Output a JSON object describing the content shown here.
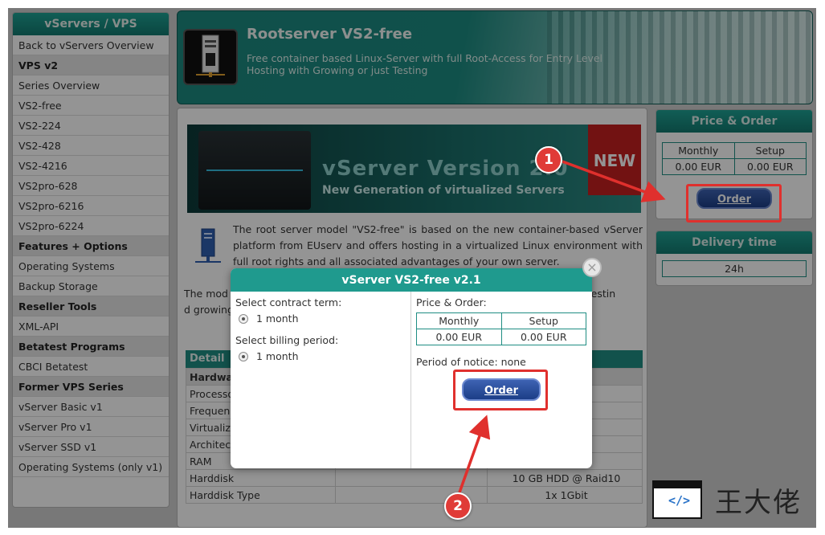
{
  "sidebar": {
    "title": "vServers / VPS",
    "items": [
      {
        "label": "Back to vServers Overview",
        "type": "item"
      },
      {
        "label": "VPS v2",
        "type": "head"
      },
      {
        "label": "Series Overview",
        "type": "item"
      },
      {
        "label": "VS2-free",
        "type": "item"
      },
      {
        "label": "VS2-224",
        "type": "item"
      },
      {
        "label": "VS2-428",
        "type": "item"
      },
      {
        "label": "VS2-4216",
        "type": "item"
      },
      {
        "label": "VS2pro-628",
        "type": "item"
      },
      {
        "label": "VS2pro-6216",
        "type": "item"
      },
      {
        "label": "VS2pro-6224",
        "type": "item"
      },
      {
        "label": "Features + Options",
        "type": "head"
      },
      {
        "label": "Operating Systems",
        "type": "item"
      },
      {
        "label": "Backup Storage",
        "type": "item"
      },
      {
        "label": "Reseller Tools",
        "type": "head"
      },
      {
        "label": "XML-API",
        "type": "item"
      },
      {
        "label": "Betatest Programs",
        "type": "head"
      },
      {
        "label": "CBCI Betatest",
        "type": "item"
      },
      {
        "label": "Former VPS Series",
        "type": "head"
      },
      {
        "label": "vServer Basic v1",
        "type": "item"
      },
      {
        "label": "vServer Pro v1",
        "type": "item"
      },
      {
        "label": "vServer SSD v1",
        "type": "item"
      },
      {
        "label": "Operating Systems (only v1)",
        "type": "item"
      }
    ]
  },
  "header": {
    "title": "Rootserver VS2-free",
    "subtitle": "Free container based Linux-Server with full Root-Access for Entry Level Hosting with Growing or just Testing"
  },
  "banner": {
    "title": "vServer Version 2.0",
    "subtitle": "New Generation of virtualized Servers",
    "new_badge": "NEW"
  },
  "description": {
    "para1": "The root server model \"VS2-free\" is based on the new container-based vServer platform from EUserv and offers hosting in a virtualized Linux environment with full root rights and all associated advantages of your own server.",
    "para2": "The mod                                                                                          nd is ideal for testin                                                                                        d growing systems."
  },
  "detail": {
    "heading": "Detail",
    "rows": [
      {
        "c1": "Hardwa",
        "c2": "",
        "c3": "",
        "sub": true
      },
      {
        "c1": "Processo",
        "c2": "",
        "c3": ""
      },
      {
        "c1": "Frequen",
        "c2": "",
        "c3": "Hz"
      },
      {
        "c1": "Virtualiz",
        "c2": "",
        "c3": "er"
      },
      {
        "c1": "Architec",
        "c2": "",
        "c3": ""
      },
      {
        "c1": "RAM",
        "c2": "",
        "c3": ""
      },
      {
        "c1": "Harddisk",
        "c2": "",
        "c3": "10 GB HDD @ Raid10"
      },
      {
        "c1": "Harddisk Type",
        "c2": "",
        "c3": "1x 1Gbit"
      }
    ]
  },
  "price_panel": {
    "title": "Price & Order",
    "col_monthly": "Monthly",
    "col_setup": "Setup",
    "monthly": "0.00 EUR",
    "setup": "0.00 EUR",
    "order_label": "Order"
  },
  "delivery_panel": {
    "title": "Delivery time",
    "value": "24h"
  },
  "modal": {
    "title": "vServer VS2-free v2.1",
    "contract_label": "Select contract term:",
    "contract_value": "1 month",
    "billing_label": "Select billing period:",
    "billing_value": "1 month",
    "price_label": "Price & Order:",
    "col_monthly": "Monthly",
    "col_setup": "Setup",
    "monthly": "0.00 EUR",
    "setup": "0.00 EUR",
    "notice": "Period of notice: none",
    "order_label": "Order",
    "close_symbol": "×"
  },
  "annotations": {
    "badge1": "1",
    "badge2": "2",
    "color": "#e0302d"
  },
  "watermark": {
    "code_glyph": "</>",
    "text": "王大佬"
  }
}
